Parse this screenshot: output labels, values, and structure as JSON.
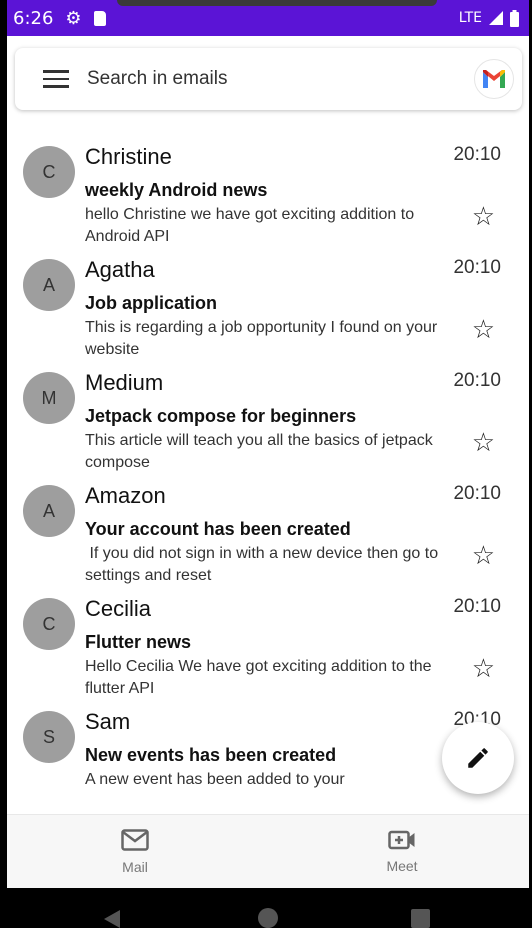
{
  "status_bar": {
    "time": "6:26",
    "network": "LTE",
    "icons": [
      "gear-icon",
      "sd-card-icon",
      "signal-icon",
      "battery-icon"
    ]
  },
  "search": {
    "placeholder": "Search in emails",
    "avatar_letter": "M"
  },
  "emails": [
    {
      "initial": "C",
      "sender": "Christine",
      "time": "20:10",
      "subject": "weekly Android news",
      "preview": "hello Christine we have got exciting addition to Android API"
    },
    {
      "initial": "A",
      "sender": "Agatha",
      "time": "20:10",
      "subject": "Job application",
      "preview": "This is regarding a job opportunity I found on your website"
    },
    {
      "initial": "M",
      "sender": "Medium",
      "time": "20:10",
      "subject": "Jetpack compose for beginners",
      "preview": "This article will teach you all the basics of jetpack compose"
    },
    {
      "initial": "A",
      "sender": "Amazon",
      "time": "20:10",
      "subject": "Your account has been created",
      "preview": " If you did not sign in with a new device then go to settings and reset"
    },
    {
      "initial": "C",
      "sender": "Cecilia",
      "time": "20:10",
      "subject": "Flutter news",
      "preview": "Hello Cecilia We have got exciting addition to the flutter API"
    },
    {
      "initial": "S",
      "sender": "Sam",
      "time": "20:10",
      "subject": "New events has been created",
      "preview": "A new event has been added to your"
    }
  ],
  "bottom_nav": {
    "mail_label": "Mail",
    "meet_label": "Meet"
  },
  "colors": {
    "status_bar": "#5b14d6",
    "avatar": "#9e9e9e"
  }
}
